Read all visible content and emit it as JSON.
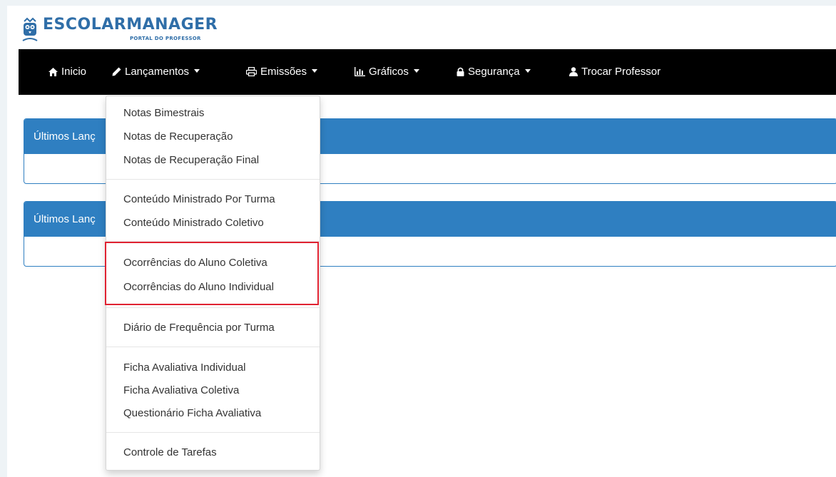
{
  "logo": {
    "title": "ESCOLARMANAGER",
    "subtitle": "PORTAL DO PROFESSOR",
    "icon": "owl-logo-icon"
  },
  "navbar": {
    "items": [
      {
        "label": "Inicio",
        "icon": "home-icon"
      },
      {
        "label": "Lançamentos",
        "icon": "pencil-icon",
        "dropdown": true
      },
      {
        "label": "Emissões",
        "icon": "print-icon",
        "dropdown": true
      },
      {
        "label": "Gráficos",
        "icon": "bar-chart-icon",
        "dropdown": true
      },
      {
        "label": "Segurança",
        "icon": "lock-icon",
        "dropdown": true
      },
      {
        "label": "Trocar Professor",
        "icon": "user-icon"
      }
    ]
  },
  "panels": [
    {
      "title": "Últimos Lanç"
    },
    {
      "title": "Últimos Lanç"
    }
  ],
  "dropdown": {
    "items": [
      "Notas Bimestrais",
      "Notas de Recuperação",
      "Notas de Recuperação Final",
      "Conteúdo Ministrado Por Turma",
      "Conteúdo Ministrado Coletivo",
      "Ocorrências do Aluno Coletiva",
      "Ocorrências do Aluno Individual",
      "Diário de Frequência por Turma",
      "Ficha Avaliativa Individual",
      "Ficha Avaliativa Coletiva",
      "Questionário Ficha Avaliativa",
      "Controle de Tarefas"
    ]
  },
  "colors": {
    "navbar": "#000000",
    "panel_header": "#2f7fc1",
    "logo": "#2f6ea8",
    "highlight": "#e02231"
  }
}
